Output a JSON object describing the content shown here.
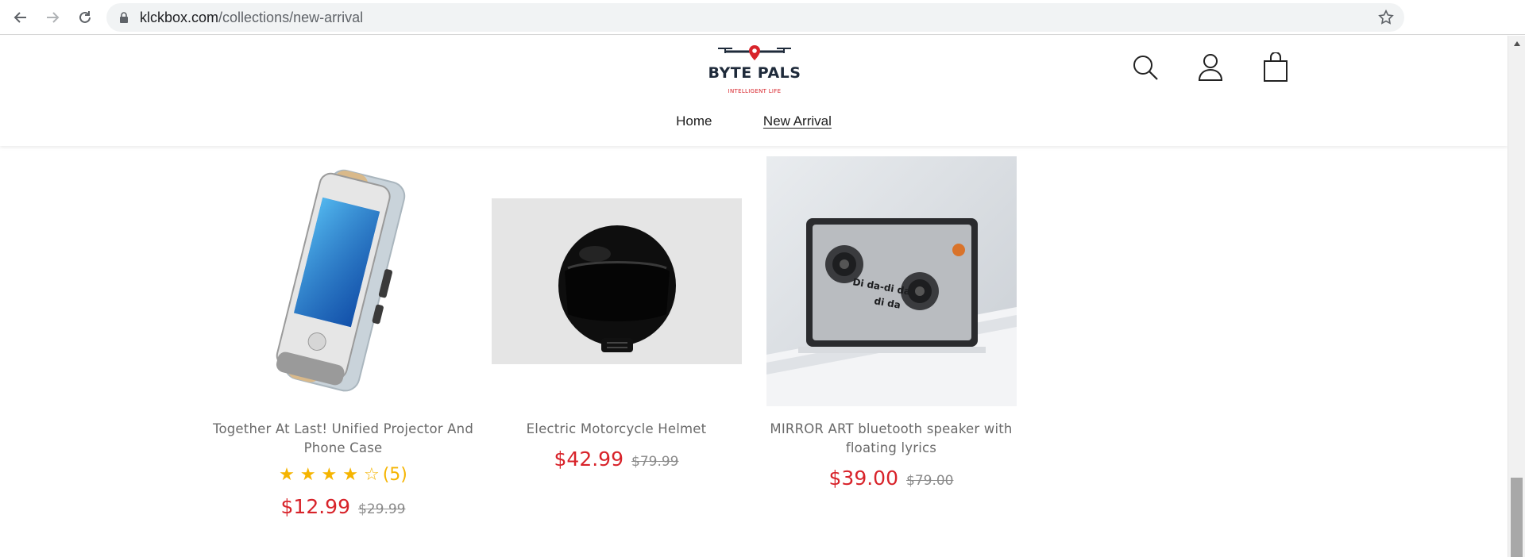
{
  "browser": {
    "url_domain": "klckbox.com",
    "url_path": "/collections/new-arrival"
  },
  "store": {
    "logo_text": "BYTE PALS",
    "logo_tagline": "INTELLIGENT LIFE",
    "nav": [
      {
        "label": "Home",
        "active": false
      },
      {
        "label": "New Arrival",
        "active": true
      }
    ]
  },
  "colors": {
    "price": "#d8232a",
    "star": "#f5b400",
    "brand_dark": "#1e2a3a"
  },
  "products": [
    {
      "name_line1": "Together At Last! Unified Projector And",
      "name_line2": "Phone Case",
      "rating": 3.5,
      "stars": "★ ★ ★ ★ ☆",
      "review_count": "(5)",
      "price": "$12.99",
      "compare_price": "$29.99"
    },
    {
      "name_line1": "Electric Motorcycle Helmet",
      "price": "$42.99",
      "compare_price": "$79.99"
    },
    {
      "name_line1": "MIRROR ART bluetooth speaker with",
      "name_line2": "floating lyrics",
      "speaker_text": "Di da-di da di da",
      "price": "$39.00",
      "compare_price": "$79.00"
    }
  ]
}
